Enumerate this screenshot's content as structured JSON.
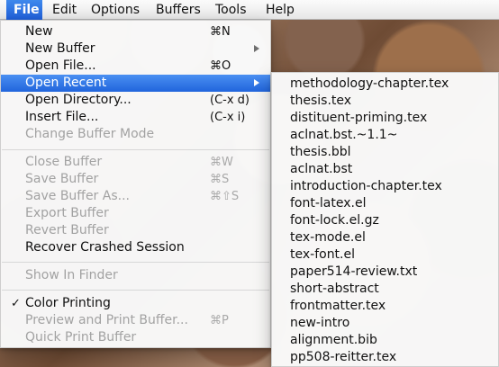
{
  "menu_bar": {
    "items": [
      "File",
      "Edit",
      "Options",
      "Buffers",
      "Tools",
      "Help"
    ]
  },
  "file_menu": {
    "items": [
      {
        "label": "New",
        "shortcut": "⌘N",
        "enabled": true
      },
      {
        "label": "New Buffer",
        "enabled": true,
        "submenu": true
      },
      {
        "label": "Open File...",
        "shortcut": "⌘O",
        "enabled": true
      },
      {
        "label": "Open Recent",
        "enabled": true,
        "submenu": true,
        "highlighted": true
      },
      {
        "label": "Open Directory...",
        "shortcut": "(C-x d)",
        "enabled": true
      },
      {
        "label": "Insert File...",
        "shortcut": "(C-x i)",
        "enabled": true
      },
      {
        "label": "Change Buffer Mode",
        "enabled": false
      },
      {
        "label": "Close Buffer",
        "shortcut": "⌘W",
        "enabled": false
      },
      {
        "label": "Save Buffer",
        "shortcut": "⌘S",
        "enabled": false
      },
      {
        "label": "Save Buffer As...",
        "shortcut": "⌘⇧S",
        "enabled": false
      },
      {
        "label": "Export Buffer",
        "enabled": false
      },
      {
        "label": "Revert Buffer",
        "enabled": false
      },
      {
        "label": "Recover Crashed Session",
        "enabled": true
      },
      {
        "label": "Show In Finder",
        "enabled": false
      },
      {
        "label": "Color Printing",
        "enabled": true,
        "checked": true
      },
      {
        "label": "Preview and Print Buffer...",
        "shortcut": "⌘P",
        "enabled": false
      },
      {
        "label": "Quick Print Buffer",
        "enabled": false
      }
    ]
  },
  "recent_menu": {
    "items": [
      "methodology-chapter.tex",
      "thesis.tex",
      "distituent-priming.tex",
      "aclnat.bst.~1.1~",
      "thesis.bbl",
      "aclnat.bst",
      "introduction-chapter.tex",
      "font-latex.el",
      "font-lock.el.gz",
      "tex-mode.el",
      "tex-font.el",
      "paper514-review.txt",
      "short-abstract",
      "frontmatter.tex",
      "new-intro",
      "alignment.bib",
      "pp508-reitter.tex"
    ]
  }
}
